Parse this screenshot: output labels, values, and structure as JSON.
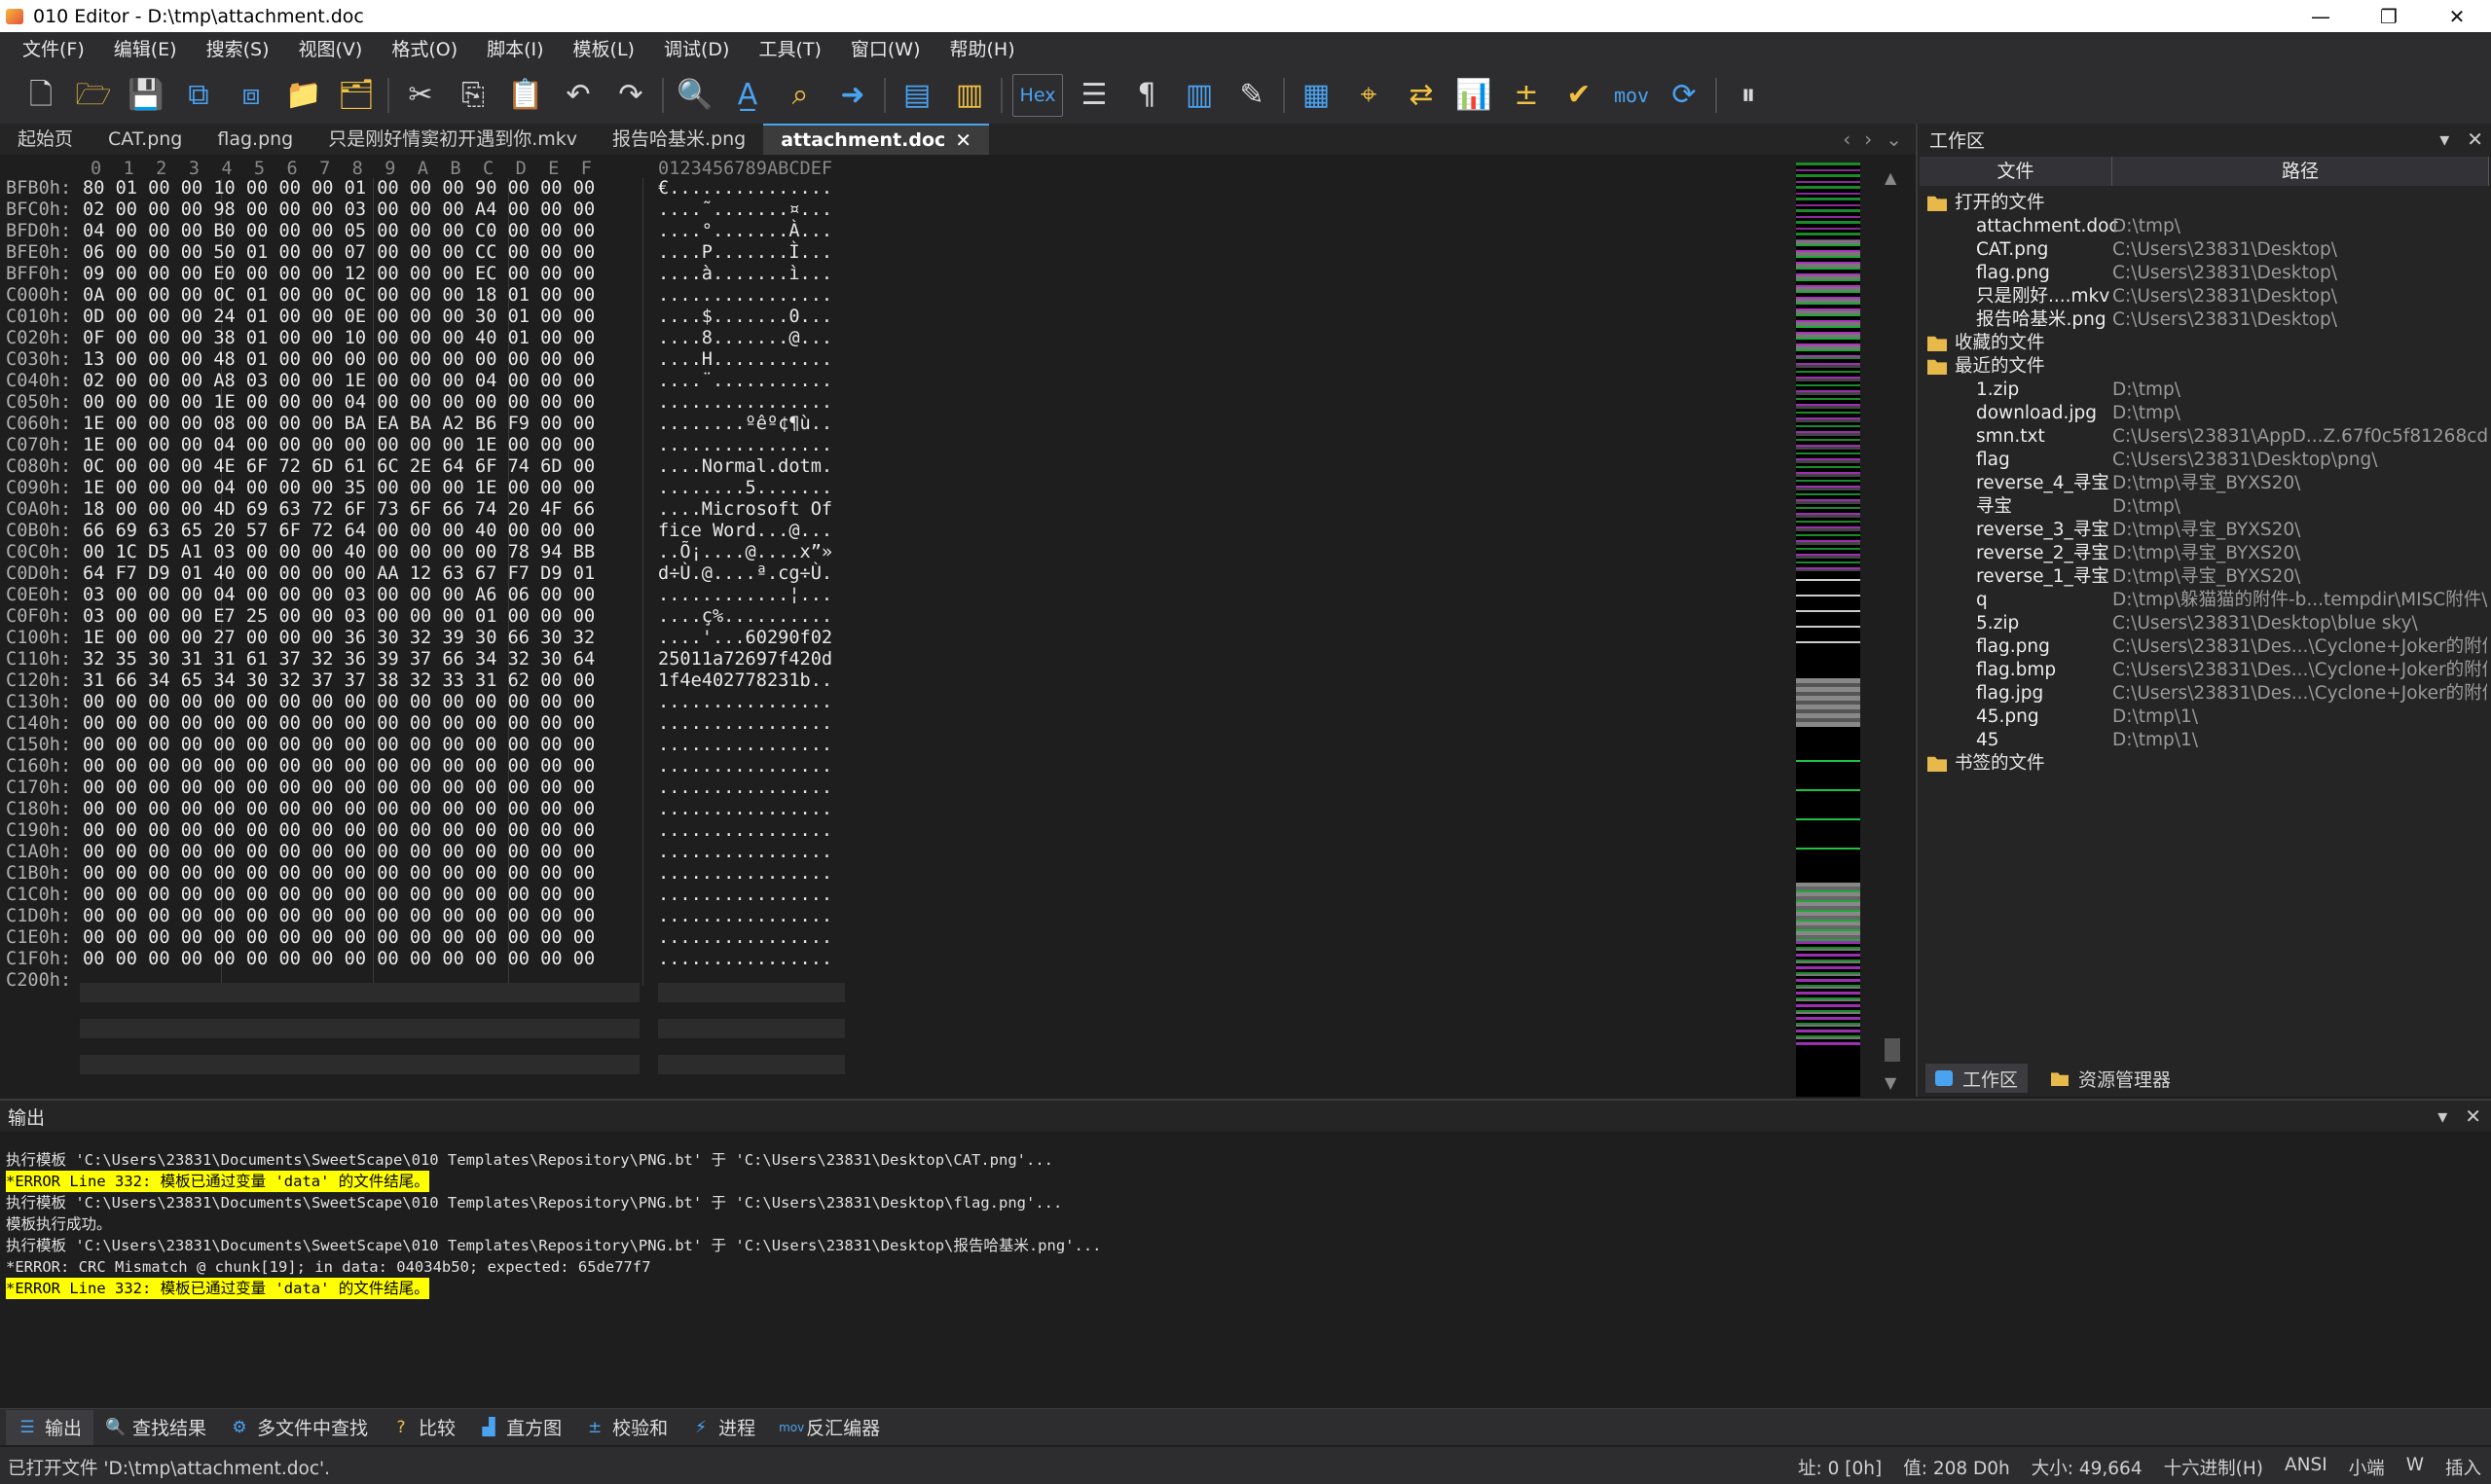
{
  "window": {
    "title": "010 Editor - D:\\tmp\\attachment.doc"
  },
  "menu": [
    "文件(F)",
    "编辑(E)",
    "搜索(S)",
    "视图(V)",
    "格式(O)",
    "脚本(I)",
    "模板(L)",
    "调试(D)",
    "工具(T)",
    "窗口(W)",
    "帮助(H)"
  ],
  "toolbar": {
    "hex_label": "Hex",
    "mov_label": "mov"
  },
  "tabs": [
    {
      "label": "起始页",
      "active": false
    },
    {
      "label": "CAT.png",
      "active": false
    },
    {
      "label": "flag.png",
      "active": false
    },
    {
      "label": "只是刚好情窦初开遇到你.mkv",
      "active": false
    },
    {
      "label": "报告哈基米.png",
      "active": false
    },
    {
      "label": "attachment.doc",
      "active": true
    }
  ],
  "hex": {
    "header_cols": "0  1  2  3  4  5  6  7  8  9  A  B  C  D  E  F",
    "header_ascii": "0123456789ABCDEF",
    "rows": [
      {
        "addr": "BFB0h:",
        "bytes": "80 01 00 00 10 00 00 00 01 00 00 00 90 00 00 00",
        "ascii": "€..............."
      },
      {
        "addr": "BFC0h:",
        "bytes": "02 00 00 00 98 00 00 00 03 00 00 00 A4 00 00 00",
        "ascii": "....˜.......¤..."
      },
      {
        "addr": "BFD0h:",
        "bytes": "04 00 00 00 B0 00 00 00 05 00 00 00 C0 00 00 00",
        "ascii": "....°.......À..."
      },
      {
        "addr": "BFE0h:",
        "bytes": "06 00 00 00 50 01 00 00 07 00 00 00 CC 00 00 00",
        "ascii": "....P.......Ì..."
      },
      {
        "addr": "BFF0h:",
        "bytes": "09 00 00 00 E0 00 00 00 12 00 00 00 EC 00 00 00",
        "ascii": "....à.......ì..."
      },
      {
        "addr": "C000h:",
        "bytes": "0A 00 00 00 0C 01 00 00 0C 00 00 00 18 01 00 00",
        "ascii": "................"
      },
      {
        "addr": "C010h:",
        "bytes": "0D 00 00 00 24 01 00 00 0E 00 00 00 30 01 00 00",
        "ascii": "....$.......0..."
      },
      {
        "addr": "C020h:",
        "bytes": "0F 00 00 00 38 01 00 00 10 00 00 00 40 01 00 00",
        "ascii": "....8.......@..."
      },
      {
        "addr": "C030h:",
        "bytes": "13 00 00 00 48 01 00 00 00 00 00 00 00 00 00 00",
        "ascii": "....H..........."
      },
      {
        "addr": "C040h:",
        "bytes": "02 00 00 00 A8 03 00 00 1E 00 00 00 04 00 00 00",
        "ascii": "....¨..........."
      },
      {
        "addr": "C050h:",
        "bytes": "00 00 00 00 1E 00 00 00 04 00 00 00 00 00 00 00",
        "ascii": "................"
      },
      {
        "addr": "C060h:",
        "bytes": "1E 00 00 00 08 00 00 00 BA EA BA A2 B6 F9 00 00",
        "ascii": "........ºêº¢¶ù.."
      },
      {
        "addr": "C070h:",
        "bytes": "1E 00 00 00 04 00 00 00 00 00 00 00 1E 00 00 00",
        "ascii": "................"
      },
      {
        "addr": "C080h:",
        "bytes": "0C 00 00 00 4E 6F 72 6D 61 6C 2E 64 6F 74 6D 00",
        "ascii": "....Normal.dotm."
      },
      {
        "addr": "C090h:",
        "bytes": "1E 00 00 00 04 00 00 00 35 00 00 00 1E 00 00 00",
        "ascii": "........5......."
      },
      {
        "addr": "C0A0h:",
        "bytes": "18 00 00 00 4D 69 63 72 6F 73 6F 66 74 20 4F 66",
        "ascii": "....Microsoft Of"
      },
      {
        "addr": "C0B0h:",
        "bytes": "66 69 63 65 20 57 6F 72 64 00 00 00 40 00 00 00",
        "ascii": "fice Word...@..."
      },
      {
        "addr": "C0C0h:",
        "bytes": "00 1C D5 A1 03 00 00 00 40 00 00 00 00 78 94 BB",
        "ascii": "..Õ¡....@....x”»"
      },
      {
        "addr": "C0D0h:",
        "bytes": "64 F7 D9 01 40 00 00 00 00 AA 12 63 67 F7 D9 01",
        "ascii": "d÷Ù.@....ª.cg÷Ù."
      },
      {
        "addr": "C0E0h:",
        "bytes": "03 00 00 00 04 00 00 00 03 00 00 00 A6 06 00 00",
        "ascii": "............¦..."
      },
      {
        "addr": "C0F0h:",
        "bytes": "03 00 00 00 E7 25 00 00 03 00 00 00 01 00 00 00",
        "ascii": "....ç%.........."
      },
      {
        "addr": "C100h:",
        "bytes": "1E 00 00 00 27 00 00 00 36 30 32 39 30 66 30 32",
        "ascii": "....'...60290f02"
      },
      {
        "addr": "C110h:",
        "bytes": "32 35 30 31 31 61 37 32 36 39 37 66 34 32 30 64",
        "ascii": "25011a72697f420d"
      },
      {
        "addr": "C120h:",
        "bytes": "31 66 34 65 34 30 32 37 37 38 32 33 31 62 00 00",
        "ascii": "1f4e402778231b.."
      },
      {
        "addr": "C130h:",
        "bytes": "00 00 00 00 00 00 00 00 00 00 00 00 00 00 00 00",
        "ascii": "................"
      },
      {
        "addr": "C140h:",
        "bytes": "00 00 00 00 00 00 00 00 00 00 00 00 00 00 00 00",
        "ascii": "................"
      },
      {
        "addr": "C150h:",
        "bytes": "00 00 00 00 00 00 00 00 00 00 00 00 00 00 00 00",
        "ascii": "................"
      },
      {
        "addr": "C160h:",
        "bytes": "00 00 00 00 00 00 00 00 00 00 00 00 00 00 00 00",
        "ascii": "................"
      },
      {
        "addr": "C170h:",
        "bytes": "00 00 00 00 00 00 00 00 00 00 00 00 00 00 00 00",
        "ascii": "................"
      },
      {
        "addr": "C180h:",
        "bytes": "00 00 00 00 00 00 00 00 00 00 00 00 00 00 00 00",
        "ascii": "................"
      },
      {
        "addr": "C190h:",
        "bytes": "00 00 00 00 00 00 00 00 00 00 00 00 00 00 00 00",
        "ascii": "................"
      },
      {
        "addr": "C1A0h:",
        "bytes": "00 00 00 00 00 00 00 00 00 00 00 00 00 00 00 00",
        "ascii": "................"
      },
      {
        "addr": "C1B0h:",
        "bytes": "00 00 00 00 00 00 00 00 00 00 00 00 00 00 00 00",
        "ascii": "................"
      },
      {
        "addr": "C1C0h:",
        "bytes": "00 00 00 00 00 00 00 00 00 00 00 00 00 00 00 00",
        "ascii": "................"
      },
      {
        "addr": "C1D0h:",
        "bytes": "00 00 00 00 00 00 00 00 00 00 00 00 00 00 00 00",
        "ascii": "................"
      },
      {
        "addr": "C1E0h:",
        "bytes": "00 00 00 00 00 00 00 00 00 00 00 00 00 00 00 00",
        "ascii": "................"
      },
      {
        "addr": "C1F0h:",
        "bytes": "00 00 00 00 00 00 00 00 00 00 00 00 00 00 00 00",
        "ascii": "................"
      },
      {
        "addr": "C200h:",
        "bytes": "",
        "ascii": ""
      }
    ]
  },
  "workspace": {
    "title": "工作区",
    "col_file": "文件",
    "col_path": "路径",
    "groups": [
      {
        "label": "打开的文件",
        "items": [
          {
            "name": "attachment.doc",
            "path": "D:\\tmp\\"
          },
          {
            "name": "CAT.png",
            "path": "C:\\Users\\23831\\Desktop\\"
          },
          {
            "name": "flag.png",
            "path": "C:\\Users\\23831\\Desktop\\"
          },
          {
            "name": "只是刚好....mkv",
            "path": "C:\\Users\\23831\\Desktop\\"
          },
          {
            "name": "报告哈基米.png",
            "path": "C:\\Users\\23831\\Desktop\\"
          }
        ]
      },
      {
        "label": "收藏的文件",
        "items": []
      },
      {
        "label": "最近的文件",
        "items": [
          {
            "name": "1.zip",
            "path": "D:\\tmp\\"
          },
          {
            "name": "download.jpg",
            "path": "D:\\tmp\\"
          },
          {
            "name": "smn.txt",
            "path": "C:\\Users\\23831\\AppD...Z.67f0c5f81268cd6a\\"
          },
          {
            "name": "flag",
            "path": "C:\\Users\\23831\\Desktop\\png\\"
          },
          {
            "name": "reverse_4_寻宝",
            "path": "D:\\tmp\\寻宝_BYXS20\\"
          },
          {
            "name": "寻宝",
            "path": "D:\\tmp\\"
          },
          {
            "name": "reverse_3_寻宝",
            "path": "D:\\tmp\\寻宝_BYXS20\\"
          },
          {
            "name": "reverse_2_寻宝",
            "path": "D:\\tmp\\寻宝_BYXS20\\"
          },
          {
            "name": "reverse_1_寻宝",
            "path": "D:\\tmp\\寻宝_BYXS20\\"
          },
          {
            "name": "q",
            "path": "D:\\tmp\\躲猫猫的附件-b...tempdir\\MISC附件\\"
          },
          {
            "name": "5.zip",
            "path": "C:\\Users\\23831\\Desktop\\blue sky\\"
          },
          {
            "name": "flag.png",
            "path": "C:\\Users\\23831\\Des...\\Cyclone+Joker的附件\\"
          },
          {
            "name": "flag.bmp",
            "path": "C:\\Users\\23831\\Des...\\Cyclone+Joker的附件\\"
          },
          {
            "name": "flag.jpg",
            "path": "C:\\Users\\23831\\Des...\\Cyclone+Joker的附件\\"
          },
          {
            "name": "45.png",
            "path": "D:\\tmp\\1\\"
          },
          {
            "name": "45",
            "path": "D:\\tmp\\1\\"
          }
        ]
      },
      {
        "label": "书签的文件",
        "items": []
      }
    ],
    "bottom_tabs": [
      "工作区",
      "资源管理器"
    ]
  },
  "output": {
    "title": "输出",
    "lines": [
      {
        "text": "执行模板 'C:\\Users\\23831\\Documents\\SweetScape\\010 Templates\\Repository\\PNG.bt' 于 'C:\\Users\\23831\\Desktop\\CAT.png'...",
        "error": false
      },
      {
        "text": "*ERROR Line 332: 模板已通过变量 'data' 的文件结尾。",
        "error": true
      },
      {
        "text": "执行模板 'C:\\Users\\23831\\Documents\\SweetScape\\010 Templates\\Repository\\PNG.bt' 于 'C:\\Users\\23831\\Desktop\\flag.png'...",
        "error": false
      },
      {
        "text": "模板执行成功。",
        "error": false
      },
      {
        "text": "执行模板 'C:\\Users\\23831\\Documents\\SweetScape\\010 Templates\\Repository\\PNG.bt' 于 'C:\\Users\\23831\\Desktop\\报告哈基米.png'...",
        "error": false
      },
      {
        "text": "*ERROR: CRC Mismatch @ chunk[19]; in data: 04034b50; expected: 65de77f7",
        "error": false
      },
      {
        "text": "*ERROR Line 332: 模板已通过变量 'data' 的文件结尾。",
        "error": true
      }
    ]
  },
  "bottom_tabs": [
    "输出",
    "查找结果",
    "多文件中查找",
    "比较",
    "直方图",
    "校验和",
    "进程",
    "反汇编器"
  ],
  "status": {
    "message": "已打开文件 'D:\\tmp\\attachment.doc'.",
    "addr": "址: 0 [0h]",
    "val": "值: 208 D0h",
    "size": "大小: 49,664",
    "mode": "十六进制(H)",
    "encoding": "ANSI",
    "endian": "小端",
    "w": "W",
    "insert": "插入"
  },
  "colors": {
    "accent": "#4aa3f0",
    "error_highlight": "#ffff00",
    "folder": "#e6b94a"
  }
}
